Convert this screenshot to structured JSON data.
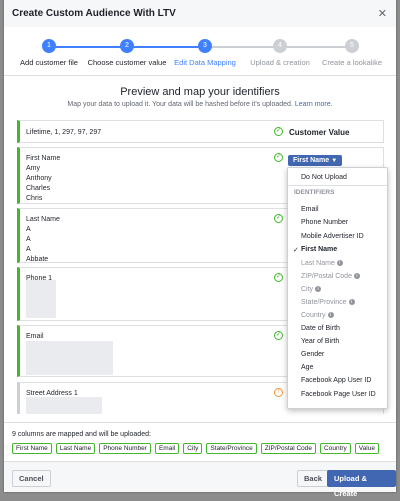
{
  "dialog": {
    "title": "Create Custom Audience With LTV"
  },
  "steps": [
    {
      "num": "1",
      "label": "Add customer file",
      "state": "done"
    },
    {
      "num": "2",
      "label": "Choose customer value",
      "state": "done"
    },
    {
      "num": "3",
      "label": "Edit Data Mapping",
      "state": "active"
    },
    {
      "num": "4",
      "label": "Upload & creation",
      "state": "todo"
    },
    {
      "num": "5",
      "label": "Create a lookalike",
      "state": "todo"
    }
  ],
  "section": {
    "title": "Preview and map your identifiers",
    "subtitle": "Map your data to upload it. Your data will be hashed before it's uploaded.",
    "learn_more": "Learn more."
  },
  "rows": {
    "lifetime": {
      "values": "Lifetime, 1, 297, 97, 297",
      "mapping": "Customer Value"
    },
    "first_name": {
      "header": "First Name",
      "values": [
        "Amy",
        "Anthony",
        "Charles",
        "Chris"
      ],
      "mapping": "First Name"
    },
    "last_name": {
      "header": "Last Name",
      "values": [
        "A",
        "A",
        "A",
        "Abbate"
      ]
    },
    "phone": {
      "header": "Phone 1"
    },
    "email": {
      "header": "Email"
    },
    "street": {
      "header": "Street Address 1"
    }
  },
  "menu": {
    "do_not_upload": "Do Not Upload",
    "identifiers_header": "IDENTIFIERS",
    "items": [
      {
        "label": "Email",
        "state": "normal"
      },
      {
        "label": "Phone Number",
        "state": "normal"
      },
      {
        "label": "Mobile Advertiser ID",
        "state": "normal"
      },
      {
        "label": "First Name",
        "state": "selected"
      },
      {
        "label": "Last Name",
        "state": "disabled"
      },
      {
        "label": "ZIP/Postal Code",
        "state": "disabled"
      },
      {
        "label": "City",
        "state": "disabled"
      },
      {
        "label": "State/Province",
        "state": "disabled"
      },
      {
        "label": "Country",
        "state": "disabled"
      },
      {
        "label": "Date of Birth",
        "state": "normal"
      },
      {
        "label": "Year of Birth",
        "state": "normal"
      },
      {
        "label": "Gender",
        "state": "normal"
      },
      {
        "label": "Age",
        "state": "normal"
      },
      {
        "label": "Facebook App User ID",
        "state": "normal"
      },
      {
        "label": "Facebook Page User ID",
        "state": "normal"
      }
    ]
  },
  "mapped": {
    "text": "9 columns are mapped and will be uploaded:",
    "chips": [
      "First Name",
      "Last Name",
      "Phone Number",
      "Email",
      "City",
      "State/Province",
      "ZIP/Postal Code",
      "Country",
      "Value"
    ]
  },
  "footer": {
    "cancel": "Cancel",
    "back": "Back",
    "upload": "Upload & Create"
  },
  "colors": {
    "accent": "#4080ff",
    "primary_button": "#4267b2",
    "success": "#42b72a",
    "warning": "#f7923b"
  }
}
